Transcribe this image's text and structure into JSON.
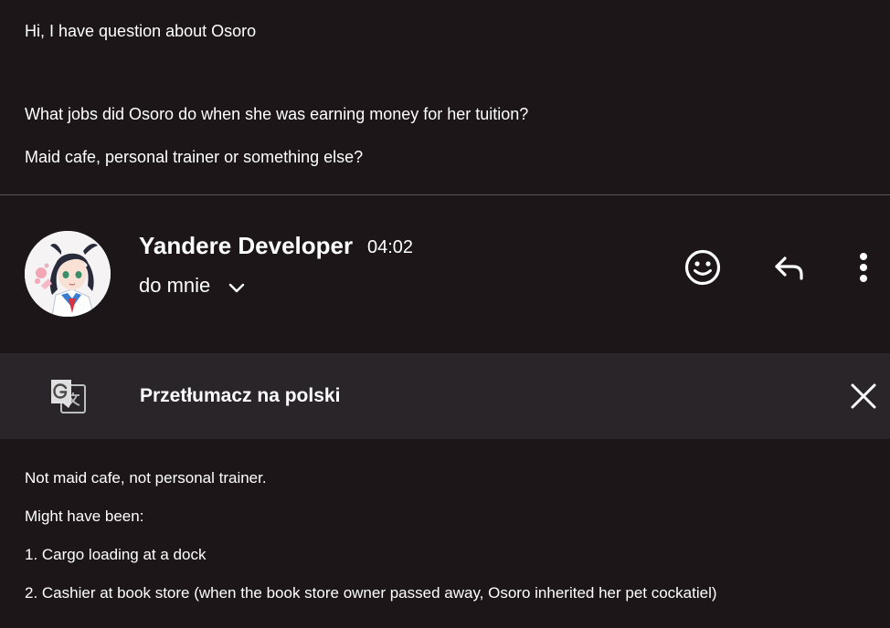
{
  "quoted_message": {
    "lines": [
      "Hi, I have question about Osoro",
      "What jobs did Osoro do when she was earning money for her tuition?",
      "Maid cafe, personal trainer or something else?"
    ]
  },
  "sender": {
    "name": "Yandere Developer",
    "time": "04:02",
    "recipient": "do mnie",
    "avatar_icon": "anime-girl-avatar"
  },
  "actions": {
    "emoji_icon": "smiley-icon",
    "reply_icon": "reply-icon",
    "more_icon": "more-vertical-icon"
  },
  "translate": {
    "label": "Przetłumacz na polski",
    "icon": "google-translate-icon",
    "close_icon": "close-icon"
  },
  "body": {
    "lines": [
      "Not maid cafe, not personal trainer.",
      "Might have been:",
      "1. Cargo loading at a dock",
      "2. Cashier at book store (when the book store owner passed away, Osoro inherited her pet cockatiel)"
    ]
  },
  "colors": {
    "background": "#1c1619",
    "translate_bar": "#2a2528",
    "divider": "#5a5558",
    "text": "#ffffff"
  }
}
